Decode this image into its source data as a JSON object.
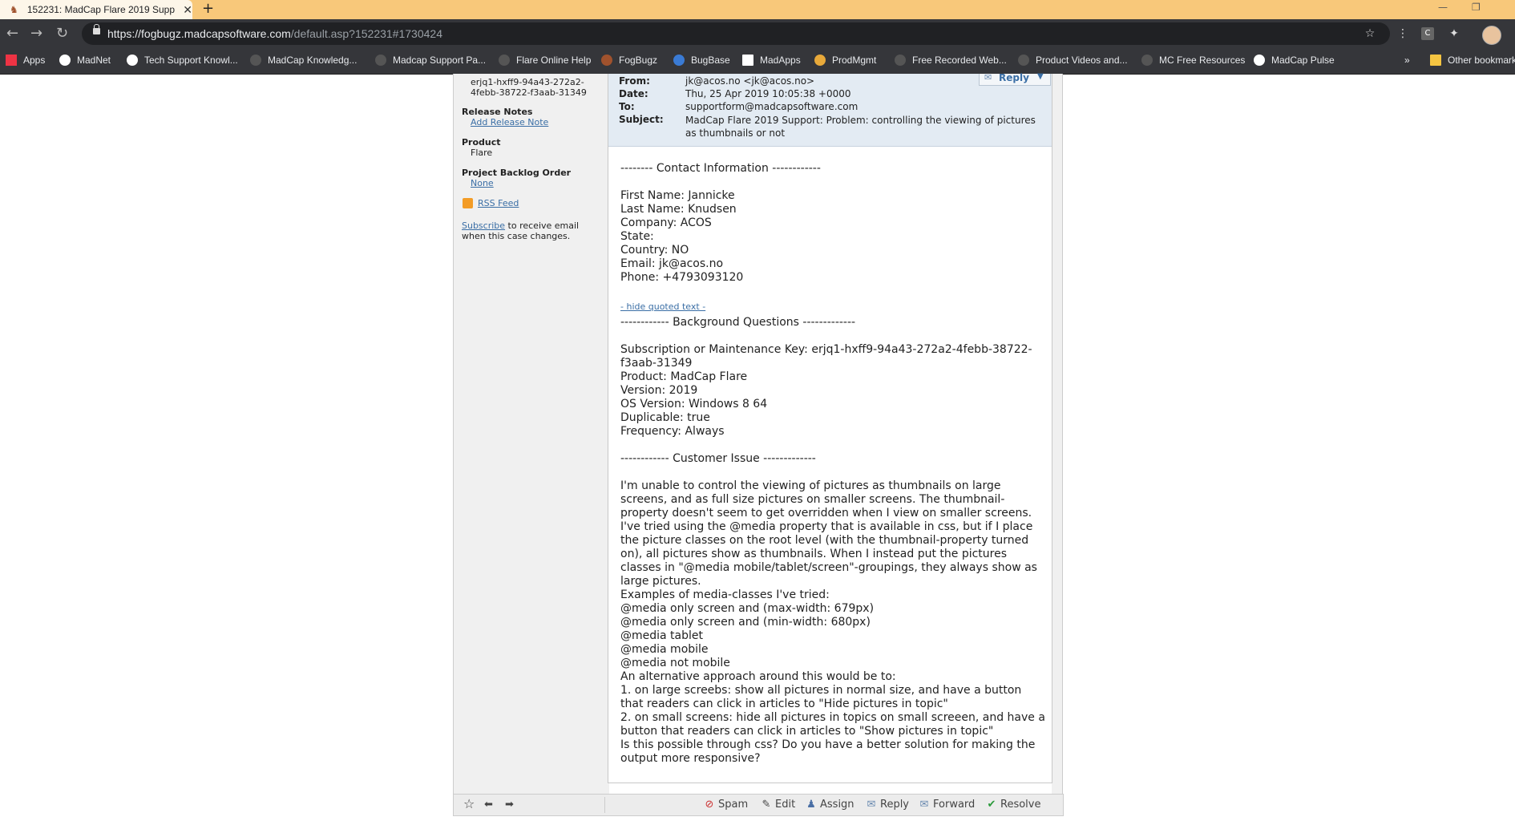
{
  "browser": {
    "tab_title": "152231: MadCap Flare 2019 Supp",
    "url_host": "https://fogbugz.madcapsoftware.com",
    "url_path": "/default.asp?152231#1730424",
    "bookmarks": [
      "Apps",
      "MadNet",
      "Tech Support Knowl...",
      "MadCap Knowledg...",
      "Madcap Support Pa...",
      "Flare Online Help",
      "FogBugz",
      "BugBase",
      "MadApps",
      "ProdMgmt",
      "Free Recorded Web...",
      "Product Videos and...",
      "MC Free Resources",
      "MadCap Pulse"
    ],
    "other_bookmarks": "Other bookmarks"
  },
  "sidebar": {
    "key_line1": "erjq1-hxff9-94a43-272a2-",
    "key_line2": "4febb-38722-f3aab-31349",
    "release_notes_label": "Release Notes",
    "add_release_note": "Add Release Note",
    "product_label": "Product",
    "product_value": "Flare",
    "backlog_label": "Project Backlog Order",
    "backlog_value": "None",
    "rss_feed": "RSS Feed",
    "subscribe_link": "Subscribe",
    "subscribe_text1": " to receive email",
    "subscribe_text2": "when this case changes."
  },
  "email": {
    "reply_label": "Reply",
    "from_label": "From:",
    "from_value": "jk@acos.no <jk@acos.no>",
    "date_label": "Date:",
    "date_value": "Thu, 25 Apr 2019 10:05:38 +0000",
    "to_label": "To:",
    "to_value": "supportform@madcapsoftware.com",
    "subject_label": "Subject:",
    "subject_value": "MadCap Flare 2019 Support: Problem: controlling the viewing of pictures as thumbnails or not",
    "contact_block": "-------- Contact Information ------------\n\nFirst Name: Jannicke\nLast Name: Knudsen\nCompany: ACOS\nState:\nCountry: NO\nEmail: jk@acos.no\nPhone: +4793093120",
    "hide_quoted": "- hide quoted text -",
    "rest_block": "------------ Background Questions -------------\n\nSubscription or Maintenance Key: erjq1-hxff9-94a43-272a2-4febb-38722-f3aab-31349\nProduct: MadCap Flare\nVersion: 2019\nOS Version: Windows 8 64\nDuplicable: true\nFrequency: Always\n\n------------ Customer Issue -------------\n\nI'm unable to control the viewing of pictures as thumbnails on large screens, and as full size pictures on smaller screens. The thumbnail-property doesn't seem to get overridden when I view on smaller screens. I've tried using the @media property that is available in css, but if I place the picture classes on the root level (with the thumbnail-property turned on), all pictures show as thumbnails. When I instead put the pictures classes in \"@media mobile/tablet/screen\"-groupings, they always show as large pictures.\nExamples of media-classes I've tried:\n@media only screen and (max-width: 679px)\n@media only screen and (min-width: 680px)\n@media tablet\n@media mobile\n@media not mobile\nAn alternative approach around this would be to:\n1. on large screebs: show all pictures in normal size, and have a button that readers can click in articles to \"Hide pictures in topic\"\n2. on small screens: hide all pictures in topics on small screeen, and have a button that readers can click in articles to \"Show pictures in topic\"\nIs this possible through css? Do you have a better solution for making the output more responsive?"
  },
  "actions": {
    "spam": "Spam",
    "edit": "Edit",
    "assign": "Assign",
    "reply": "Reply",
    "forward": "Forward",
    "resolve": "Resolve"
  }
}
